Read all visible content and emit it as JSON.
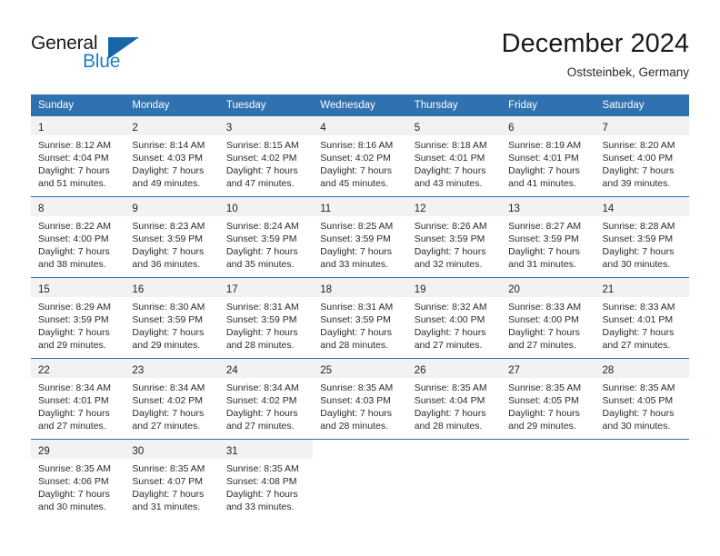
{
  "brand": {
    "word_one": "General",
    "word_two": "Blue",
    "triangle_color": "#1567a8",
    "blue_text_color": "#1c7fc4"
  },
  "header": {
    "title": "December 2024",
    "location": "Oststeinbek, Germany"
  },
  "theme": {
    "header_blue": "#3071b0",
    "daynum_band": "#f2f2f2",
    "page_background": "#ffffff",
    "text": "#2b2b2b"
  },
  "calendar": {
    "day_headers": [
      "Sunday",
      "Monday",
      "Tuesday",
      "Wednesday",
      "Thursday",
      "Friday",
      "Saturday"
    ],
    "weeks": [
      [
        {
          "day": "1",
          "sunrise": "Sunrise: 8:12 AM",
          "sunset": "Sunset: 4:04 PM",
          "daylight_1": "Daylight: 7 hours",
          "daylight_2": "and 51 minutes."
        },
        {
          "day": "2",
          "sunrise": "Sunrise: 8:14 AM",
          "sunset": "Sunset: 4:03 PM",
          "daylight_1": "Daylight: 7 hours",
          "daylight_2": "and 49 minutes."
        },
        {
          "day": "3",
          "sunrise": "Sunrise: 8:15 AM",
          "sunset": "Sunset: 4:02 PM",
          "daylight_1": "Daylight: 7 hours",
          "daylight_2": "and 47 minutes."
        },
        {
          "day": "4",
          "sunrise": "Sunrise: 8:16 AM",
          "sunset": "Sunset: 4:02 PM",
          "daylight_1": "Daylight: 7 hours",
          "daylight_2": "and 45 minutes."
        },
        {
          "day": "5",
          "sunrise": "Sunrise: 8:18 AM",
          "sunset": "Sunset: 4:01 PM",
          "daylight_1": "Daylight: 7 hours",
          "daylight_2": "and 43 minutes."
        },
        {
          "day": "6",
          "sunrise": "Sunrise: 8:19 AM",
          "sunset": "Sunset: 4:01 PM",
          "daylight_1": "Daylight: 7 hours",
          "daylight_2": "and 41 minutes."
        },
        {
          "day": "7",
          "sunrise": "Sunrise: 8:20 AM",
          "sunset": "Sunset: 4:00 PM",
          "daylight_1": "Daylight: 7 hours",
          "daylight_2": "and 39 minutes."
        }
      ],
      [
        {
          "day": "8",
          "sunrise": "Sunrise: 8:22 AM",
          "sunset": "Sunset: 4:00 PM",
          "daylight_1": "Daylight: 7 hours",
          "daylight_2": "and 38 minutes."
        },
        {
          "day": "9",
          "sunrise": "Sunrise: 8:23 AM",
          "sunset": "Sunset: 3:59 PM",
          "daylight_1": "Daylight: 7 hours",
          "daylight_2": "and 36 minutes."
        },
        {
          "day": "10",
          "sunrise": "Sunrise: 8:24 AM",
          "sunset": "Sunset: 3:59 PM",
          "daylight_1": "Daylight: 7 hours",
          "daylight_2": "and 35 minutes."
        },
        {
          "day": "11",
          "sunrise": "Sunrise: 8:25 AM",
          "sunset": "Sunset: 3:59 PM",
          "daylight_1": "Daylight: 7 hours",
          "daylight_2": "and 33 minutes."
        },
        {
          "day": "12",
          "sunrise": "Sunrise: 8:26 AM",
          "sunset": "Sunset: 3:59 PM",
          "daylight_1": "Daylight: 7 hours",
          "daylight_2": "and 32 minutes."
        },
        {
          "day": "13",
          "sunrise": "Sunrise: 8:27 AM",
          "sunset": "Sunset: 3:59 PM",
          "daylight_1": "Daylight: 7 hours",
          "daylight_2": "and 31 minutes."
        },
        {
          "day": "14",
          "sunrise": "Sunrise: 8:28 AM",
          "sunset": "Sunset: 3:59 PM",
          "daylight_1": "Daylight: 7 hours",
          "daylight_2": "and 30 minutes."
        }
      ],
      [
        {
          "day": "15",
          "sunrise": "Sunrise: 8:29 AM",
          "sunset": "Sunset: 3:59 PM",
          "daylight_1": "Daylight: 7 hours",
          "daylight_2": "and 29 minutes."
        },
        {
          "day": "16",
          "sunrise": "Sunrise: 8:30 AM",
          "sunset": "Sunset: 3:59 PM",
          "daylight_1": "Daylight: 7 hours",
          "daylight_2": "and 29 minutes."
        },
        {
          "day": "17",
          "sunrise": "Sunrise: 8:31 AM",
          "sunset": "Sunset: 3:59 PM",
          "daylight_1": "Daylight: 7 hours",
          "daylight_2": "and 28 minutes."
        },
        {
          "day": "18",
          "sunrise": "Sunrise: 8:31 AM",
          "sunset": "Sunset: 3:59 PM",
          "daylight_1": "Daylight: 7 hours",
          "daylight_2": "and 28 minutes."
        },
        {
          "day": "19",
          "sunrise": "Sunrise: 8:32 AM",
          "sunset": "Sunset: 4:00 PM",
          "daylight_1": "Daylight: 7 hours",
          "daylight_2": "and 27 minutes."
        },
        {
          "day": "20",
          "sunrise": "Sunrise: 8:33 AM",
          "sunset": "Sunset: 4:00 PM",
          "daylight_1": "Daylight: 7 hours",
          "daylight_2": "and 27 minutes."
        },
        {
          "day": "21",
          "sunrise": "Sunrise: 8:33 AM",
          "sunset": "Sunset: 4:01 PM",
          "daylight_1": "Daylight: 7 hours",
          "daylight_2": "and 27 minutes."
        }
      ],
      [
        {
          "day": "22",
          "sunrise": "Sunrise: 8:34 AM",
          "sunset": "Sunset: 4:01 PM",
          "daylight_1": "Daylight: 7 hours",
          "daylight_2": "and 27 minutes."
        },
        {
          "day": "23",
          "sunrise": "Sunrise: 8:34 AM",
          "sunset": "Sunset: 4:02 PM",
          "daylight_1": "Daylight: 7 hours",
          "daylight_2": "and 27 minutes."
        },
        {
          "day": "24",
          "sunrise": "Sunrise: 8:34 AM",
          "sunset": "Sunset: 4:02 PM",
          "daylight_1": "Daylight: 7 hours",
          "daylight_2": "and 27 minutes."
        },
        {
          "day": "25",
          "sunrise": "Sunrise: 8:35 AM",
          "sunset": "Sunset: 4:03 PM",
          "daylight_1": "Daylight: 7 hours",
          "daylight_2": "and 28 minutes."
        },
        {
          "day": "26",
          "sunrise": "Sunrise: 8:35 AM",
          "sunset": "Sunset: 4:04 PM",
          "daylight_1": "Daylight: 7 hours",
          "daylight_2": "and 28 minutes."
        },
        {
          "day": "27",
          "sunrise": "Sunrise: 8:35 AM",
          "sunset": "Sunset: 4:05 PM",
          "daylight_1": "Daylight: 7 hours",
          "daylight_2": "and 29 minutes."
        },
        {
          "day": "28",
          "sunrise": "Sunrise: 8:35 AM",
          "sunset": "Sunset: 4:05 PM",
          "daylight_1": "Daylight: 7 hours",
          "daylight_2": "and 30 minutes."
        }
      ],
      [
        {
          "day": "29",
          "sunrise": "Sunrise: 8:35 AM",
          "sunset": "Sunset: 4:06 PM",
          "daylight_1": "Daylight: 7 hours",
          "daylight_2": "and 30 minutes."
        },
        {
          "day": "30",
          "sunrise": "Sunrise: 8:35 AM",
          "sunset": "Sunset: 4:07 PM",
          "daylight_1": "Daylight: 7 hours",
          "daylight_2": "and 31 minutes."
        },
        {
          "day": "31",
          "sunrise": "Sunrise: 8:35 AM",
          "sunset": "Sunset: 4:08 PM",
          "daylight_1": "Daylight: 7 hours",
          "daylight_2": "and 33 minutes."
        },
        {
          "day": "",
          "sunrise": "",
          "sunset": "",
          "daylight_1": "",
          "daylight_2": ""
        },
        {
          "day": "",
          "sunrise": "",
          "sunset": "",
          "daylight_1": "",
          "daylight_2": ""
        },
        {
          "day": "",
          "sunrise": "",
          "sunset": "",
          "daylight_1": "",
          "daylight_2": ""
        },
        {
          "day": "",
          "sunrise": "",
          "sunset": "",
          "daylight_1": "",
          "daylight_2": ""
        }
      ]
    ]
  }
}
